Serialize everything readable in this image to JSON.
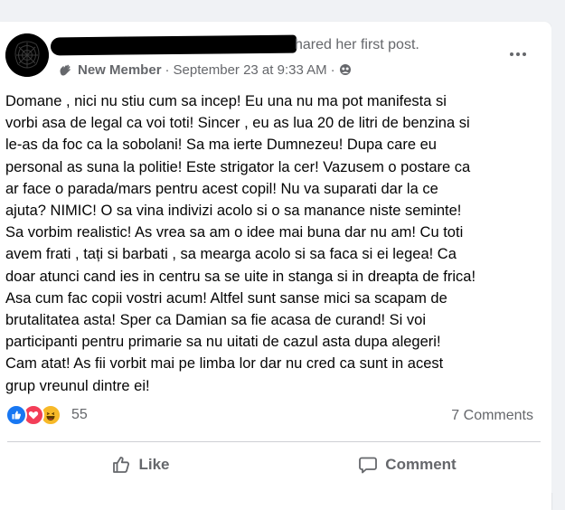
{
  "post": {
    "author_suffix": "hared her first post.",
    "badge_label": "New Member",
    "separator": "·",
    "timestamp": "September 23 at 9:33 AM",
    "separator2": "·",
    "body_lines": [
      "Domane , nici nu stiu cum sa incep! Eu una nu ma pot manifesta si",
      "vorbi asa de legal ca voi toti! Sincer , eu as lua 20 de litri de benzina si",
      "le-as da foc ca la sobolani! Sa ma ierte Dumnezeu! Dupa care eu",
      "personal as suna la politie! Este strigator la cer! Vazusem o postare ca",
      "ar face o parada/mars pentru acest copil! Nu va suparati dar la ce",
      "ajuta? NIMIC! O sa vina indivizi acolo si o sa manance niste seminte!",
      "Sa vorbim realistic! As vrea sa am o idee mai buna dar nu am! Cu toti",
      "avem frati , tați si barbati , sa mearga acolo si sa faca si ei legea! Ca",
      "doar atunci cand ies in centru sa se uite in stanga si in dreapta de frica!",
      "Asa cum fac copii vostri acum!  Altfel sunt sanse mici sa scapam de",
      "brutalitatea asta! Sper ca Damian sa fie acasa de curand! Si voi",
      "participanti pentru primarie sa nu uitati de cazul asta dupa alegeri!",
      "Cam atat! As fii vorbit mai pe limba lor dar nu cred ca sunt in acest",
      "grup vreunul dintre ei!"
    ]
  },
  "reactions": {
    "types": [
      "like-icon",
      "love-icon",
      "haha-icon"
    ],
    "count": "55"
  },
  "comments": {
    "count_label": "7 Comments"
  },
  "actions": {
    "like_label": "Like",
    "comment_label": "Comment"
  },
  "colors": {
    "accent_like": "#1877f2",
    "accent_love": "#f33e58",
    "accent_haha": "#f7b928",
    "secondary_text": "#65676b"
  }
}
